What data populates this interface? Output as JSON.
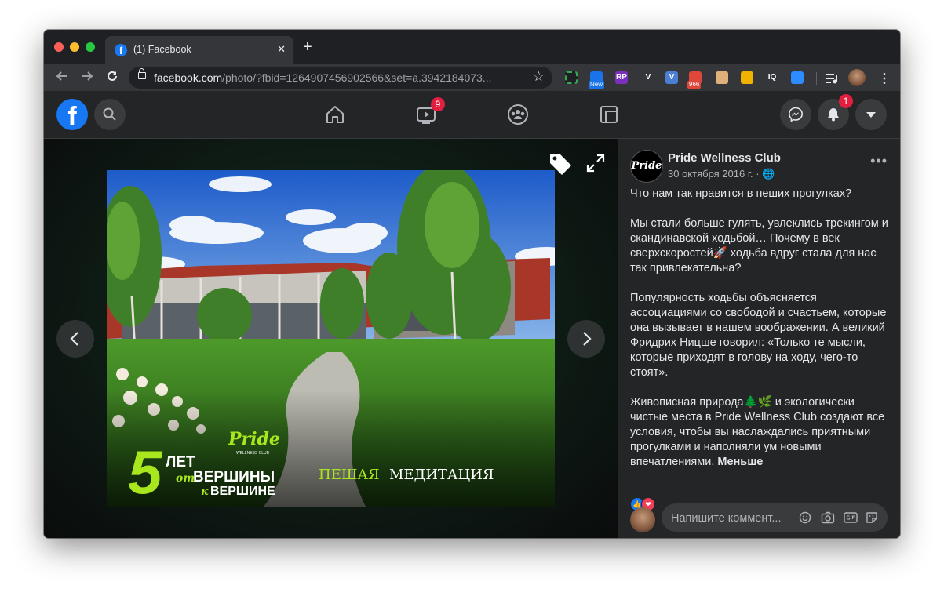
{
  "browser": {
    "tab_title": "(1) Facebook",
    "new_tab_symbol": "+",
    "close_symbol": "✕",
    "url_host": "facebook.com",
    "url_path": "/photo/?fbid=1264907456902566&set=a.3942184073...",
    "extensions": [
      {
        "name": "ext-capture-icon",
        "label": "",
        "color": "#1f2023"
      },
      {
        "name": "ext-rainbow-icon",
        "label": "New",
        "color": "#1a73e8"
      },
      {
        "name": "ext-rp-icon",
        "label": "RP",
        "color": "#7b2fbe"
      },
      {
        "name": "ext-v-icon",
        "label": "V",
        "color": "#35363a"
      },
      {
        "name": "ext-vnote-icon",
        "label": "V",
        "color": "#4a7fd4"
      },
      {
        "name": "ext-mail-icon",
        "label": "966",
        "color": "#e0473a"
      },
      {
        "name": "ext-face-icon",
        "label": "",
        "color": "#e0b07a"
      },
      {
        "name": "ext-bookmark-icon",
        "label": "",
        "color": "#f0b400"
      },
      {
        "name": "ext-iq-icon",
        "label": "IQ",
        "color": "#35363a"
      },
      {
        "name": "ext-zoom-icon",
        "label": "",
        "color": "#2d8cff"
      },
      {
        "name": "ext-media-icon",
        "label": "",
        "color": "#35363a"
      }
    ]
  },
  "fb_header": {
    "logo_letter": "f",
    "watch_badge": "9",
    "notifications_badge": "1"
  },
  "photo": {
    "overlay_number": "5",
    "overlay_let": "ЛЕТ",
    "overlay_ot": "от",
    "overlay_vershiny": "ВЕРШИНЫ",
    "overlay_k": "к",
    "overlay_vershine": "ВЕРШИНЕ",
    "overlay_brand": "Pride",
    "overlay_brand_sub": "WELLNESS CLUB",
    "caption_accent": "ПЕШАЯ",
    "caption_rest": "МЕДИТАЦИЯ"
  },
  "post": {
    "page_name": "Pride Wellness Club",
    "avatar_text": "Pride",
    "date": "30 октября 2016 г. · 🌐",
    "more": "•••",
    "paragraphs": [
      "Что нам так нравится в пеших прогулках?",
      "Мы стали больше гулять, увлеклись трекингом и скандинавской ходьбой… Почему в век сверхскоростей🚀 ходьба вдруг стала для нас так привлекательна?",
      "Популярность ходьбы объясняется ассоциациями со свободой и счастьем, которые она вызывает в нашем воображении. А великий Фридрих Ницше говорил: «Только те мысли, которые приходят в голову на ходу, чего-то стоят».",
      "Живописная природа🌲🌿 и экологически чистые места в Pride Wellness Club создают все условия, чтобы вы наслаждались приятными прогулками и наполняли ум новыми впечатлениями."
    ],
    "less_label": "Меньше",
    "reactions": [
      "👍",
      "❤"
    ]
  },
  "comment": {
    "placeholder": "Напишите коммент..."
  }
}
